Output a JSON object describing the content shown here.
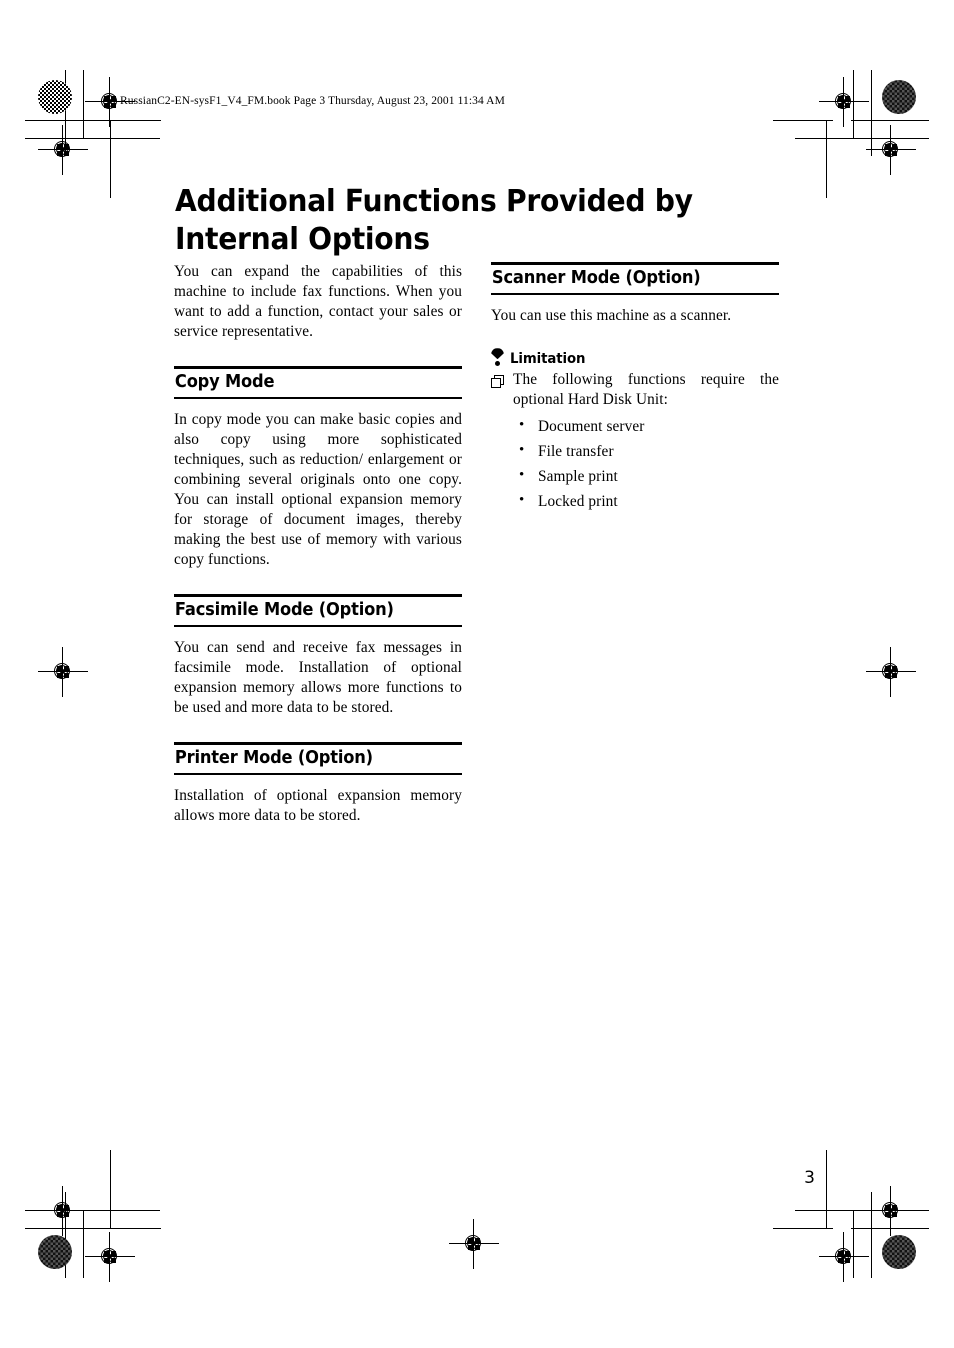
{
  "header": {
    "file_name": "RussianC2-EN-sysF1_V4_FM.book",
    "page_label": "Page 3",
    "timestamp": "Thursday, August 23, 2001  11:34 AM",
    "full_line": "RussianC2-EN-sysF1_V4_FM.book  Page 3  Thursday, August 23, 2001  11:34 AM"
  },
  "title": "Additional Functions Provided by Internal Options",
  "intro": "You can expand the capabilities of this machine to include fax functions. When you want to add a function, contact your sales or service representative.",
  "left_column": {
    "sections": [
      {
        "heading": "Copy Mode",
        "body": "In copy mode you can make basic copies and also copy using more sophisticated techniques, such as reduction/ enlargement or combining several originals onto one copy. You can install optional expansion memory for storage of document images, thereby making the best use of memory with various copy functions."
      },
      {
        "heading": "Facsimile Mode (Option)",
        "body": "You can send and receive fax messages in facsimile mode. Installation of optional expansion memory allows more functions to be used and more data to be stored."
      },
      {
        "heading": "Printer Mode (Option)",
        "body": "Installation of optional expansion memory allows more data to be stored."
      }
    ]
  },
  "right_column": {
    "sections": [
      {
        "heading": "Scanner Mode (Option)",
        "body": "You can use this machine as a scanner."
      }
    ],
    "limitation": {
      "icon": "limitation-bulb-icon",
      "label": "Limitation",
      "note_marker_icon": "double-square-marker-icon",
      "note": "The following functions require the optional Hard Disk Unit:",
      "bullets": [
        "Document server",
        "File transfer",
        "Sample print",
        "Locked print"
      ]
    }
  },
  "folio": "3",
  "colors": {
    "text": "#000000",
    "page_background": "#ffffff",
    "rule": "#000000"
  }
}
